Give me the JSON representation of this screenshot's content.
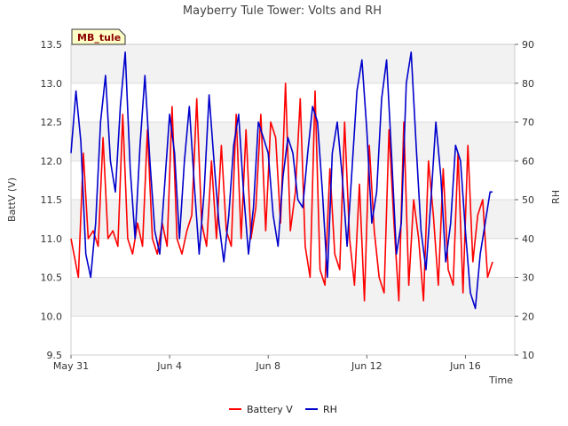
{
  "chart_data": {
    "type": "line",
    "title": "Mayberry Tule Tower: Volts and RH",
    "site_badge": "MB_tule",
    "xlabel": "Time",
    "ylabel_left": "BattV (V)",
    "ylabel_right": "RH",
    "x_ticks": [
      "May 31",
      "Jun 4",
      "Jun 8",
      "Jun 12",
      "Jun 16"
    ],
    "x_tick_days": [
      0,
      4,
      8,
      12,
      16
    ],
    "xlim_days": [
      0,
      18
    ],
    "ylim_left": [
      9.5,
      13.5
    ],
    "yticks_left": [
      "9.5",
      "10.0",
      "10.5",
      "11.0",
      "11.5",
      "12.0",
      "12.5",
      "13.0",
      "13.5"
    ],
    "ylim_right": [
      10,
      90
    ],
    "yticks_right": [
      "10",
      "20",
      "30",
      "40",
      "50",
      "60",
      "70",
      "80",
      "90"
    ],
    "grid": "horizontal bands",
    "legend_position": "bottom-center",
    "series": [
      {
        "name": "Battery V",
        "axis": "left",
        "color": "#ff0000",
        "x_days": [
          0.0,
          0.3,
          0.5,
          0.7,
          0.9,
          1.1,
          1.3,
          1.5,
          1.7,
          1.9,
          2.1,
          2.3,
          2.5,
          2.7,
          2.9,
          3.1,
          3.3,
          3.5,
          3.7,
          3.9,
          4.1,
          4.3,
          4.5,
          4.7,
          4.9,
          5.1,
          5.3,
          5.5,
          5.7,
          5.9,
          6.1,
          6.3,
          6.5,
          6.7,
          6.9,
          7.1,
          7.3,
          7.5,
          7.7,
          7.9,
          8.1,
          8.3,
          8.5,
          8.7,
          8.9,
          9.1,
          9.3,
          9.5,
          9.7,
          9.9,
          10.1,
          10.3,
          10.5,
          10.7,
          10.9,
          11.1,
          11.3,
          11.5,
          11.7,
          11.9,
          12.1,
          12.3,
          12.5,
          12.7,
          12.9,
          13.1,
          13.3,
          13.5,
          13.7,
          13.9,
          14.1,
          14.3,
          14.5,
          14.7,
          14.9,
          15.1,
          15.3,
          15.5,
          15.7,
          15.9,
          16.1,
          16.3,
          16.5,
          16.7,
          16.9,
          17.1
        ],
        "values": [
          11.0,
          10.5,
          12.1,
          11.0,
          11.1,
          10.9,
          12.3,
          11.0,
          11.1,
          10.9,
          12.6,
          11.0,
          10.8,
          11.2,
          10.9,
          12.4,
          11.0,
          10.8,
          11.2,
          10.9,
          12.7,
          11.0,
          10.8,
          11.1,
          11.3,
          12.8,
          11.2,
          10.9,
          12.0,
          11.0,
          12.2,
          11.1,
          10.9,
          12.6,
          11.0,
          12.4,
          11.0,
          11.4,
          12.6,
          11.1,
          12.5,
          12.3,
          11.2,
          13.0,
          11.1,
          11.6,
          12.8,
          10.9,
          10.5,
          12.9,
          10.6,
          10.4,
          11.9,
          10.8,
          10.6,
          12.5,
          11.0,
          10.4,
          11.7,
          10.2,
          12.2,
          11.1,
          10.5,
          10.3,
          12.4,
          11.2,
          10.2,
          12.5,
          10.4,
          11.5,
          11.0,
          10.2,
          12.0,
          11.3,
          10.4,
          11.9,
          10.6,
          10.4,
          12.1,
          10.3,
          12.2,
          10.7,
          11.3,
          11.5,
          10.5,
          10.7
        ]
      },
      {
        "name": "RH",
        "axis": "right",
        "color": "#0000cc",
        "x_days": [
          0.0,
          0.2,
          0.4,
          0.6,
          0.8,
          1.0,
          1.2,
          1.4,
          1.6,
          1.8,
          2.0,
          2.2,
          2.4,
          2.6,
          2.8,
          3.0,
          3.2,
          3.4,
          3.6,
          3.8,
          4.0,
          4.2,
          4.4,
          4.6,
          4.8,
          5.0,
          5.2,
          5.4,
          5.6,
          5.8,
          6.0,
          6.2,
          6.4,
          6.6,
          6.8,
          7.0,
          7.2,
          7.4,
          7.6,
          7.8,
          8.0,
          8.2,
          8.4,
          8.6,
          8.8,
          9.0,
          9.2,
          9.4,
          9.6,
          9.8,
          10.0,
          10.2,
          10.4,
          10.6,
          10.8,
          11.0,
          11.2,
          11.4,
          11.6,
          11.8,
          12.0,
          12.2,
          12.4,
          12.6,
          12.8,
          13.0,
          13.2,
          13.4,
          13.6,
          13.8,
          14.0,
          14.2,
          14.4,
          14.6,
          14.8,
          15.0,
          15.2,
          15.4,
          15.6,
          15.8,
          16.0,
          16.2,
          16.4,
          16.6,
          16.8,
          17.0,
          17.1
        ],
        "values": [
          62,
          78,
          65,
          36,
          30,
          44,
          70,
          82,
          60,
          52,
          74,
          88,
          58,
          40,
          64,
          82,
          60,
          42,
          36,
          54,
          72,
          62,
          40,
          60,
          74,
          54,
          36,
          52,
          77,
          60,
          44,
          34,
          46,
          64,
          72,
          52,
          36,
          48,
          70,
          66,
          62,
          46,
          38,
          56,
          66,
          62,
          50,
          48,
          62,
          74,
          70,
          52,
          30,
          62,
          70,
          56,
          38,
          58,
          78,
          86,
          68,
          44,
          52,
          76,
          86,
          62,
          36,
          44,
          80,
          88,
          64,
          42,
          32,
          50,
          70,
          56,
          34,
          44,
          64,
          60,
          42,
          26,
          22,
          36,
          44,
          52,
          52
        ]
      }
    ]
  }
}
